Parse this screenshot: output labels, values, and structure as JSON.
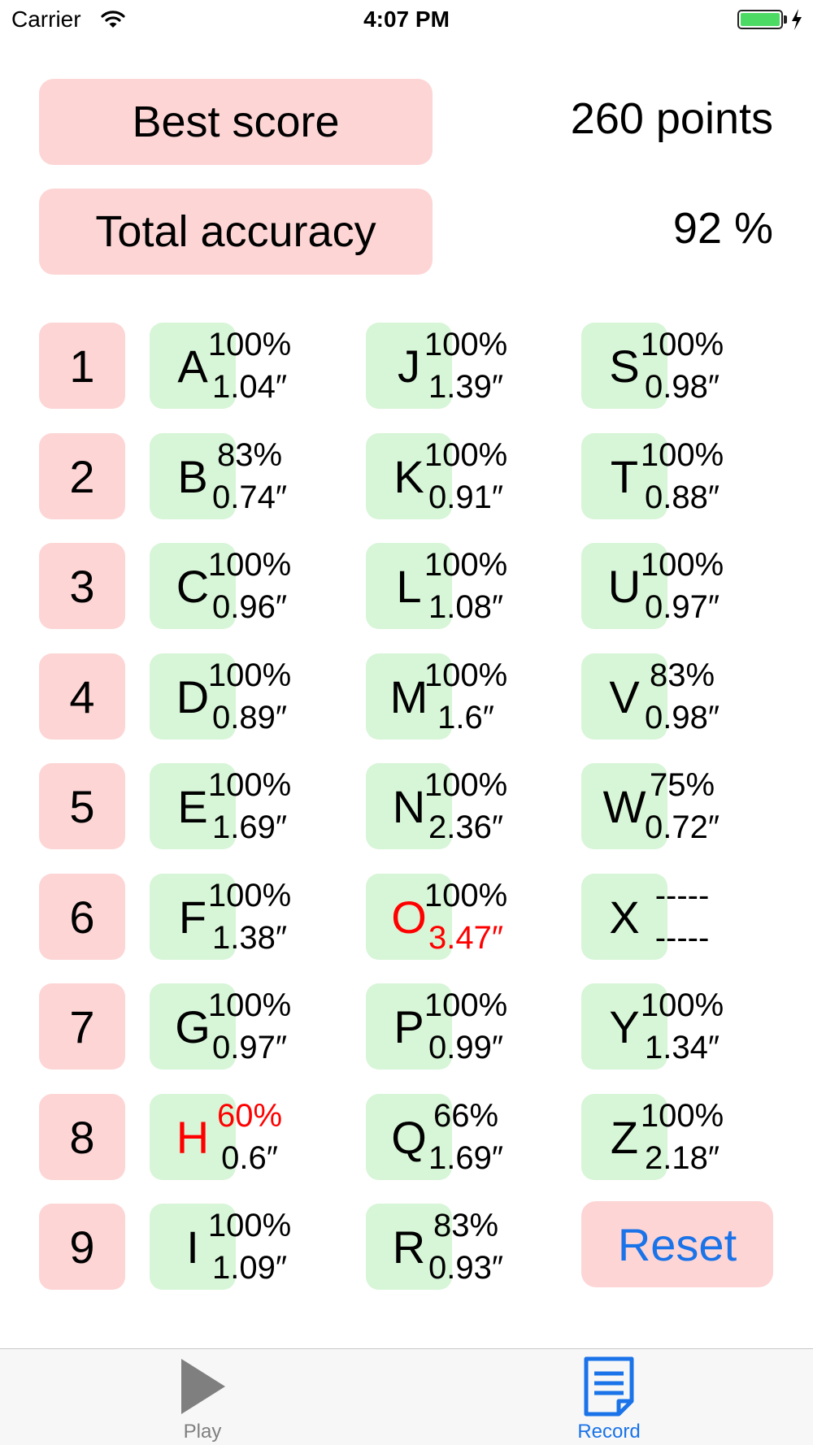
{
  "status_bar": {
    "carrier": "Carrier",
    "time": "4:07 PM"
  },
  "best_score": {
    "label": "Best score",
    "value": "260 points"
  },
  "total_accuracy": {
    "label": "Total accuracy",
    "value": "92 %"
  },
  "numbers": [
    "1",
    "2",
    "3",
    "4",
    "5",
    "6",
    "7",
    "8",
    "9"
  ],
  "letters": [
    {
      "letter": "A",
      "accuracy": "100%",
      "time": "1.04″"
    },
    {
      "letter": "B",
      "accuracy": "83%",
      "time": "0.74″"
    },
    {
      "letter": "C",
      "accuracy": "100%",
      "time": "0.96″"
    },
    {
      "letter": "D",
      "accuracy": "100%",
      "time": "0.89″"
    },
    {
      "letter": "E",
      "accuracy": "100%",
      "time": "1.69″"
    },
    {
      "letter": "F",
      "accuracy": "100%",
      "time": "1.38″"
    },
    {
      "letter": "G",
      "accuracy": "100%",
      "time": "0.97″"
    },
    {
      "letter": "H",
      "accuracy": "60%",
      "time": "0.6″",
      "letter_color": "#ff0000",
      "accuracy_color": "#ff0000"
    },
    {
      "letter": "I",
      "accuracy": "100%",
      "time": "1.09″"
    },
    {
      "letter": "J",
      "accuracy": "100%",
      "time": "1.39″"
    },
    {
      "letter": "K",
      "accuracy": "100%",
      "time": "0.91″"
    },
    {
      "letter": "L",
      "accuracy": "100%",
      "time": "1.08″"
    },
    {
      "letter": "M",
      "accuracy": "100%",
      "time": "1.6″"
    },
    {
      "letter": "N",
      "accuracy": "100%",
      "time": "2.36″"
    },
    {
      "letter": "O",
      "accuracy": "100%",
      "time": "3.47″",
      "letter_color": "#ff0000",
      "time_color": "#ff0000"
    },
    {
      "letter": "P",
      "accuracy": "100%",
      "time": "0.99″"
    },
    {
      "letter": "Q",
      "accuracy": "66%",
      "time": "1.69″"
    },
    {
      "letter": "R",
      "accuracy": "83%",
      "time": "0.93″"
    },
    {
      "letter": "S",
      "accuracy": "100%",
      "time": "0.98″"
    },
    {
      "letter": "T",
      "accuracy": "100%",
      "time": "0.88″"
    },
    {
      "letter": "U",
      "accuracy": "100%",
      "time": "0.97″"
    },
    {
      "letter": "V",
      "accuracy": "83%",
      "time": "0.98″"
    },
    {
      "letter": "W",
      "accuracy": "75%",
      "time": "0.72″"
    },
    {
      "letter": "X",
      "accuracy": "-----",
      "time": "-----"
    },
    {
      "letter": "Y",
      "accuracy": "100%",
      "time": "1.34″"
    },
    {
      "letter": "Z",
      "accuracy": "100%",
      "time": "2.18″"
    }
  ],
  "reset_label": "Reset",
  "tabs": [
    {
      "label": "Play",
      "icon": "play-icon",
      "selected": false
    },
    {
      "label": "Record",
      "icon": "document-icon",
      "selected": true
    }
  ],
  "colors": {
    "pink_tile": "#fdd5d5",
    "green_tile": "#d7f5d7",
    "error_red": "#ff0000",
    "accent_blue": "#1a73e8",
    "inactive_gray": "#7f7f7f"
  }
}
